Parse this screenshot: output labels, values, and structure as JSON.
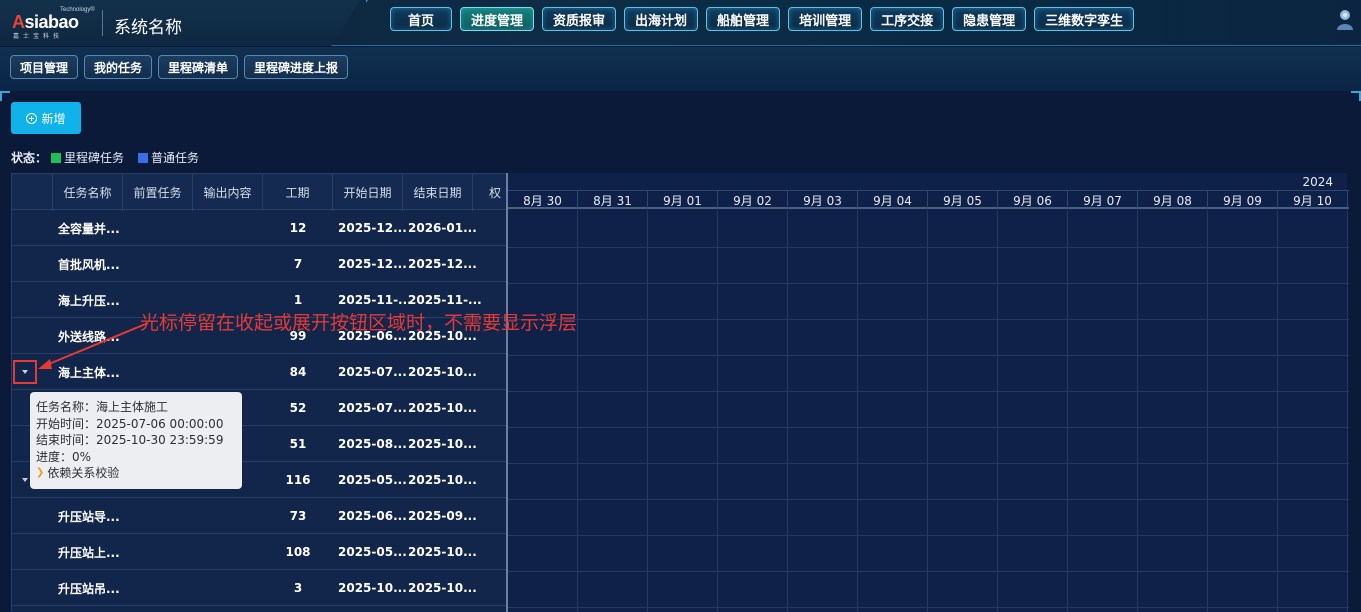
{
  "brand": {
    "logo_top": "Technology®",
    "logo_main_a": "A",
    "logo_main_rest": "siabao",
    "logo_sub": "嘉士宝科技",
    "system_name": "系统名称"
  },
  "topnav": [
    "首页",
    "进度管理",
    "资质报审",
    "出海计划",
    "船舶管理",
    "培训管理",
    "工序交接",
    "隐患管理",
    "三维数字孪生"
  ],
  "topnav_active": "进度管理",
  "subnav": [
    "项目管理",
    "我的任务",
    "里程碑清单",
    "里程碑进度上报"
  ],
  "toolbar": {
    "add_label": "新增"
  },
  "legend": {
    "label": "状态：",
    "items": [
      {
        "label": "里程碑任务",
        "color": "#1fbf5a"
      },
      {
        "label": "普通任务",
        "color": "#3a6fe8"
      }
    ]
  },
  "table": {
    "columns": [
      "任务名称",
      "前置任务",
      "输出内容",
      "工期",
      "开始日期",
      "结束日期",
      "权"
    ],
    "rows": [
      {
        "name": "全容量并...",
        "duration": "12",
        "start": "2025-12...",
        "end": "2026-01...",
        "toggle": ""
      },
      {
        "name": "首批风机...",
        "duration": "7",
        "start": "2025-12...",
        "end": "2025-12...",
        "toggle": ""
      },
      {
        "name": "海上升压...",
        "duration": "1",
        "start": "2025-11-...",
        "end": "2025-11-...",
        "toggle": ""
      },
      {
        "name": "外送线路...",
        "duration": "99",
        "start": "2025-06...",
        "end": "2025-10...",
        "toggle": ""
      },
      {
        "name": "海上主体...",
        "duration": "84",
        "start": "2025-07...",
        "end": "2025-10...",
        "toggle": "boxed"
      },
      {
        "name": "",
        "duration": "52",
        "start": "2025-07...",
        "end": "2025-10...",
        "toggle": ""
      },
      {
        "name": "",
        "duration": "51",
        "start": "2025-08...",
        "end": "2025-10...",
        "toggle": ""
      },
      {
        "name": "",
        "duration": "116",
        "start": "2025-05...",
        "end": "2025-10...",
        "toggle": "plain"
      },
      {
        "name": "升压站导...",
        "duration": "73",
        "start": "2025-06...",
        "end": "2025-09...",
        "toggle": ""
      },
      {
        "name": "升压站上...",
        "duration": "108",
        "start": "2025-05...",
        "end": "2025-10...",
        "toggle": ""
      },
      {
        "name": "升压站吊...",
        "duration": "3",
        "start": "2025-10...",
        "end": "2025-10...",
        "toggle": ""
      }
    ]
  },
  "gantt": {
    "year": "2024",
    "days": [
      "8月 30",
      "8月 31",
      "9月 01",
      "9月 02",
      "9月 03",
      "9月 04",
      "9月 05",
      "9月 06",
      "9月 07",
      "9月 08",
      "9月 09",
      "9月 10"
    ]
  },
  "tooltip": {
    "name": "任务名称：海上主体施工",
    "start": "开始时间：2025-07-06 00:00:00",
    "end": "结束时间：2025-10-30 23:59:59",
    "progress": "进度：0%",
    "dep_label": "依赖关系校验"
  },
  "annotation": {
    "text": "光标停留在收起或展开按钮区域时，不需要显示浮层"
  },
  "colors": {
    "accent": "#0fb3ea",
    "annotation": "#e53935"
  }
}
